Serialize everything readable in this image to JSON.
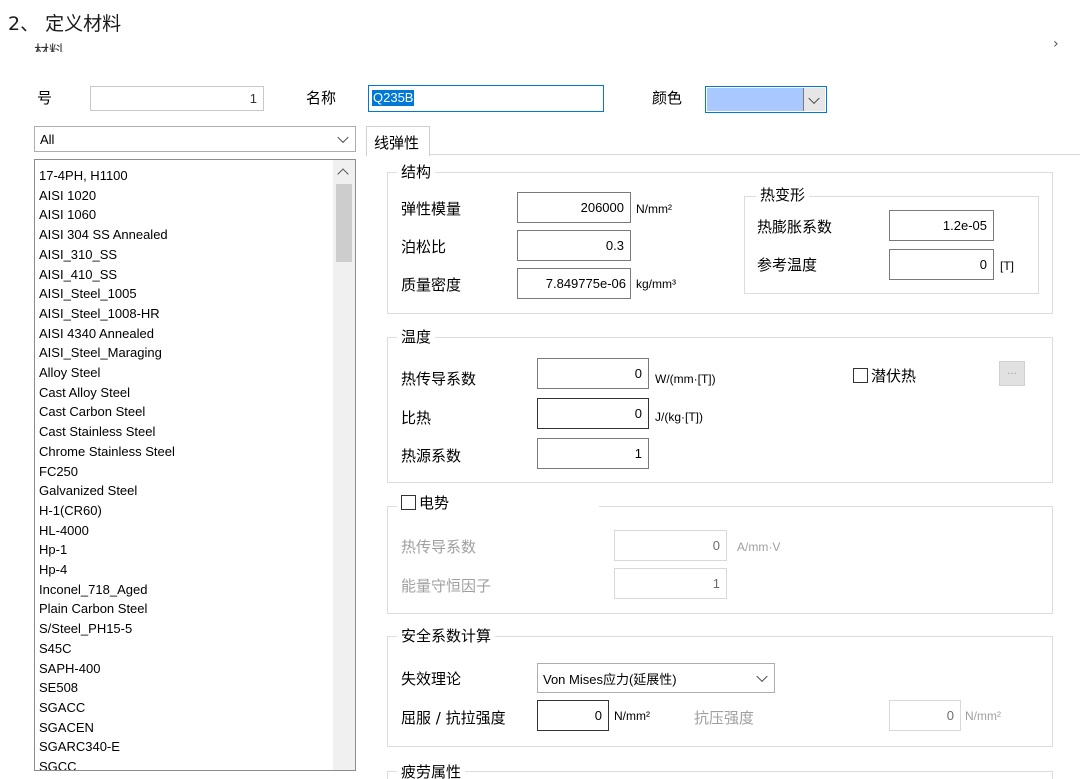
{
  "doc_heading": "2、 定义材料",
  "dialog": {
    "title_partial": "材料",
    "close_glyph": "›",
    "number_label": "号",
    "number_value": "1",
    "name_label": "名称",
    "name_value": "Q235B",
    "color_label": "颜色",
    "color_swatch": "#a8c8ff",
    "filter_value": "All",
    "materials": [
      "17-4PH, H1100",
      "AISI 1020",
      "AISI 1060",
      "AISI 304 SS Annealed",
      "AISI_310_SS",
      "AISI_410_SS",
      "AISI_Steel_1005",
      "AISI_Steel_1008-HR",
      "AISI 4340 Annealed",
      "AISI_Steel_Maraging",
      "Alloy Steel",
      "Cast Alloy Steel",
      "Cast Carbon Steel",
      "Cast Stainless Steel",
      "Chrome Stainless Steel",
      "FC250",
      "Galvanized Steel",
      "H-1(CR60)",
      "HL-4000",
      "Hp-1",
      "Hp-4",
      "Inconel_718_Aged",
      "Plain Carbon Steel",
      "S/Steel_PH15-5",
      "S45C",
      "SAPH-400",
      "SE508",
      "SGACC",
      "SGACEN",
      "SGARC340-E",
      "SGCC"
    ],
    "tab_label": "线弹性",
    "structure": {
      "title": "结构",
      "elastic_modulus_label": "弹性模量",
      "elastic_modulus_value": "206000",
      "elastic_modulus_unit": "N/mm²",
      "poisson_label": "泊松比",
      "poisson_value": "0.3",
      "density_label": "质量密度",
      "density_value": "7.849775e-06",
      "density_unit": "kg/mm³",
      "thermal_deform": {
        "title": "热变形",
        "expansion_label": "热膨胀系数",
        "expansion_value": "1.2e-05",
        "ref_temp_label": "参考温度",
        "ref_temp_value": "0",
        "ref_temp_unit": "[T]"
      }
    },
    "temperature": {
      "title": "温度",
      "conductivity_label": "热传导系数",
      "conductivity_value": "0",
      "conductivity_unit": "W/(mm·[T])",
      "specific_heat_label": "比热",
      "specific_heat_value": "0",
      "specific_heat_unit": "J/(kg·[T])",
      "heat_source_label": "热源系数",
      "heat_source_value": "1",
      "latent_heat_label": "潜伏热",
      "latent_button_label": "..."
    },
    "electric": {
      "title": "电势",
      "conductivity_label": "热传导系数",
      "conductivity_value": "0",
      "conductivity_unit": "A/mm·V",
      "energy_factor_label": "能量守恒因子",
      "energy_factor_value": "1"
    },
    "safety": {
      "title": "安全系数计算",
      "theory_label": "失效理论",
      "theory_value": "Von Mises应力(延展性)",
      "yield_label": "屈服 / 抗拉强度",
      "yield_value": "0",
      "yield_unit": "N/mm²",
      "compressive_label": "抗压强度",
      "compressive_value": "0",
      "compressive_unit": "N/mm²"
    },
    "fatigue_partial": "疲劳属性"
  }
}
